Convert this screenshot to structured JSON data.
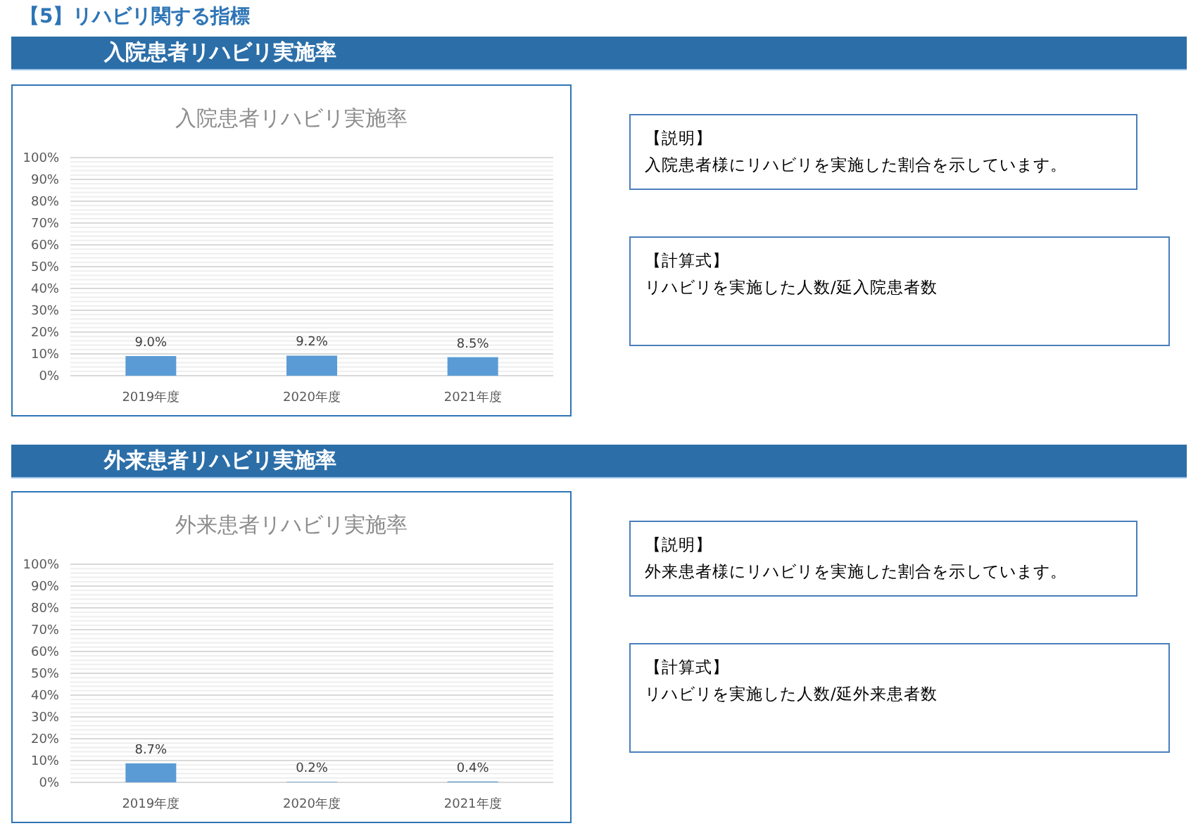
{
  "heading": "【5】リハビリ関する指標",
  "sections": [
    {
      "title": "入院患者リハビリ実施率",
      "chart_data": {
        "type": "bar",
        "grid": true,
        "title": "入院患者リハビリ実施率",
        "categories": [
          "2019年度",
          "2020年度",
          "2021年度"
        ],
        "values": [
          9.0,
          9.2,
          8.5
        ],
        "value_labels": [
          "9.0%",
          "9.2%",
          "8.5%"
        ],
        "ylim": [
          0,
          100
        ],
        "yticks": [
          {
            "value": 0,
            "label": "0%"
          },
          {
            "value": 10,
            "label": "10%"
          },
          {
            "value": 20,
            "label": "20%"
          },
          {
            "value": 30,
            "label": "30%"
          },
          {
            "value": 40,
            "label": "40%"
          },
          {
            "value": 50,
            "label": "50%"
          },
          {
            "value": 60,
            "label": "60%"
          },
          {
            "value": 70,
            "label": "70%"
          },
          {
            "value": 80,
            "label": "80%"
          },
          {
            "value": 90,
            "label": "90%"
          },
          {
            "value": 100,
            "label": "100%"
          }
        ]
      },
      "notes": [
        {
          "heading": "【説明】",
          "text": "入院患者様にリハビリを実施した割合を示しています。"
        },
        {
          "heading": "【計算式】",
          "text": "リハビリを実施した人数/延入院患者数"
        }
      ]
    },
    {
      "title": "外来患者リハビリ実施率",
      "chart_data": {
        "type": "bar",
        "grid": true,
        "title": "外来患者リハビリ実施率",
        "categories": [
          "2019年度",
          "2020年度",
          "2021年度"
        ],
        "values": [
          8.7,
          0.2,
          0.4
        ],
        "value_labels": [
          "8.7%",
          "0.2%",
          "0.4%"
        ],
        "ylim": [
          0,
          100
        ],
        "yticks": [
          {
            "value": 0,
            "label": "0%"
          },
          {
            "value": 10,
            "label": "10%"
          },
          {
            "value": 20,
            "label": "20%"
          },
          {
            "value": 30,
            "label": "30%"
          },
          {
            "value": 40,
            "label": "40%"
          },
          {
            "value": 50,
            "label": "50%"
          },
          {
            "value": 60,
            "label": "60%"
          },
          {
            "value": 70,
            "label": "70%"
          },
          {
            "value": 80,
            "label": "80%"
          },
          {
            "value": 90,
            "label": "90%"
          },
          {
            "value": 100,
            "label": "100%"
          }
        ]
      },
      "notes": [
        {
          "heading": "【説明】",
          "text": "外来患者様にリハビリを実施した割合を示しています。"
        },
        {
          "heading": "【計算式】",
          "text": "リハビリを実施した人数/延外来患者数"
        }
      ]
    }
  ]
}
